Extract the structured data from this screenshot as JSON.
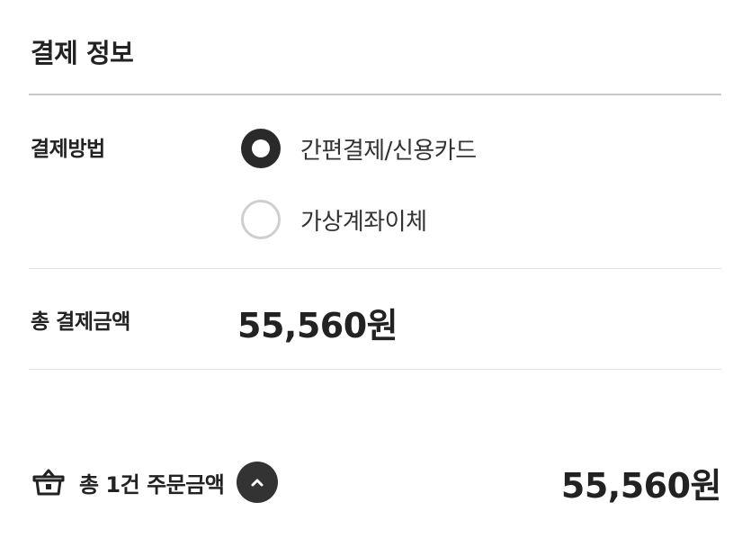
{
  "payment": {
    "title": "결제 정보",
    "method_label": "결제방법",
    "options": [
      {
        "label": "간편결제/신용카드",
        "selected": true
      },
      {
        "label": "가상계좌이체",
        "selected": false
      }
    ],
    "total_label": "총 결제금액",
    "total_amount": "55,560원"
  },
  "footer": {
    "icon": "basket-icon",
    "summary_label": "총 1건 주문금액",
    "toggle_icon": "chevron-up-icon",
    "amount": "55,560원"
  },
  "colors": {
    "text": "#222222",
    "radio_checked": "#2a2a2a",
    "radio_unchecked_border": "#cfcfcf",
    "divider": "#e4e4e4",
    "toggle_bg": "#333333"
  }
}
